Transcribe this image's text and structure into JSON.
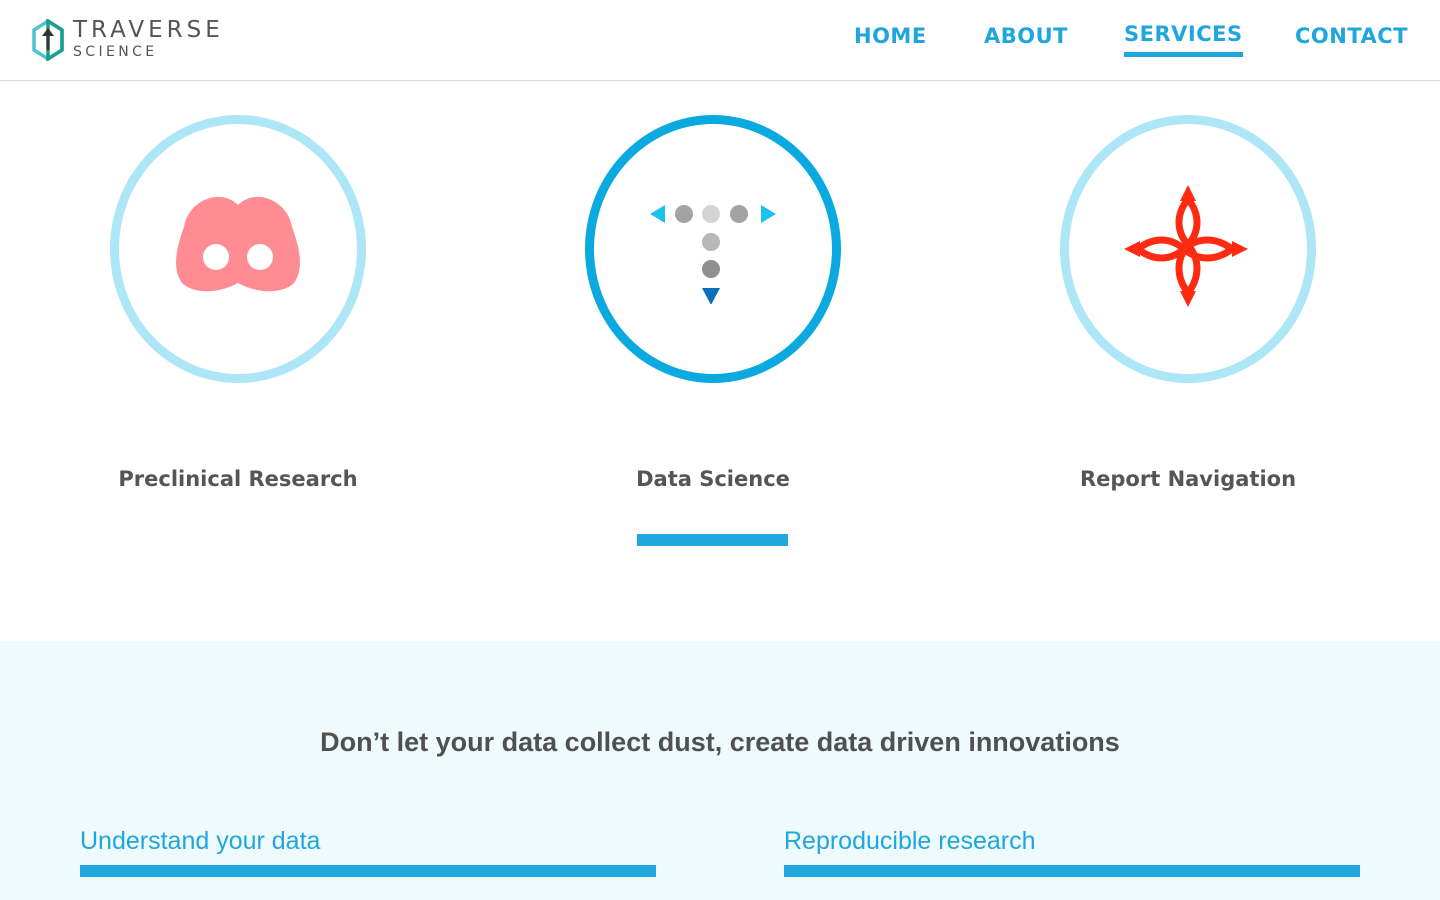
{
  "brand": {
    "name": "TRAVERSE",
    "subtitle": "SCIENCE",
    "accent_color": "#1fa6dc",
    "logo_colors": [
      "#4fc3d0",
      "#1aa08a",
      "#333333"
    ]
  },
  "nav": {
    "items": [
      {
        "label": "HOME",
        "active": false
      },
      {
        "label": "ABOUT",
        "active": false
      },
      {
        "label": "SERVICES",
        "active": true
      },
      {
        "label": "CONTACT",
        "active": false
      }
    ]
  },
  "services": [
    {
      "label": "Preclinical Research",
      "icon": "pig-snout-icon",
      "active": false,
      "icon_color": "#ff8c93"
    },
    {
      "label": "Data Science",
      "icon": "data-dots-icon",
      "active": true,
      "icon_color": "#0aa9df"
    },
    {
      "label": "Report Navigation",
      "icon": "compass-arrows-icon",
      "active": false,
      "icon_color": "#ff2a12"
    }
  ],
  "content": {
    "tagline": "Don’t let your data collect dust, create data driven innovations",
    "features": [
      {
        "title": "Understand your data"
      },
      {
        "title": "Reproducible research"
      }
    ],
    "band_color": "#effafc"
  }
}
